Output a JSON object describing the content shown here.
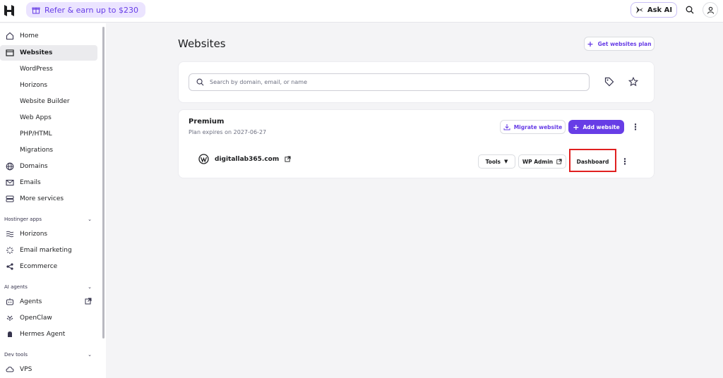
{
  "topbar": {
    "refer_label": "Refer & earn up to $230",
    "ask_ai_label": "Ask AI"
  },
  "sidebar": {
    "items": [
      {
        "label": "Home",
        "icon": "home-icon"
      },
      {
        "label": "Websites",
        "icon": "window-icon",
        "active": true
      },
      {
        "label": "Domains",
        "icon": "globe-icon"
      },
      {
        "label": "Emails",
        "icon": "mail-icon"
      },
      {
        "label": "More services",
        "icon": "server-icon"
      }
    ],
    "website_subitems": [
      "WordPress",
      "Horizons",
      "Website Builder",
      "Web Apps",
      "PHP/HTML",
      "Migrations"
    ],
    "sections": {
      "hostinger_apps": {
        "title": "Hostinger apps",
        "items": [
          "Horizons",
          "Email marketing",
          "Ecommerce"
        ]
      },
      "ai_agents": {
        "title": "AI agents",
        "items": [
          "Agents",
          "OpenClaw",
          "Hermes Agent"
        ]
      },
      "dev_tools": {
        "title": "Dev tools",
        "items": [
          "VPS"
        ]
      }
    }
  },
  "main": {
    "title": "Websites",
    "get_plan_label": "Get websites plan",
    "search_placeholder": "Search by domain, email, or name",
    "plan": {
      "name": "Premium",
      "expires": "Plan expires on 2027-06-27",
      "migrate_label": "Migrate website",
      "add_label": "Add website"
    },
    "site": {
      "domain": "digitallab365.com",
      "tools_label": "Tools",
      "wp_admin_label": "WP Admin",
      "dashboard_label": "Dashboard"
    }
  },
  "colors": {
    "accent": "#673de6",
    "highlight": "#e02020"
  }
}
